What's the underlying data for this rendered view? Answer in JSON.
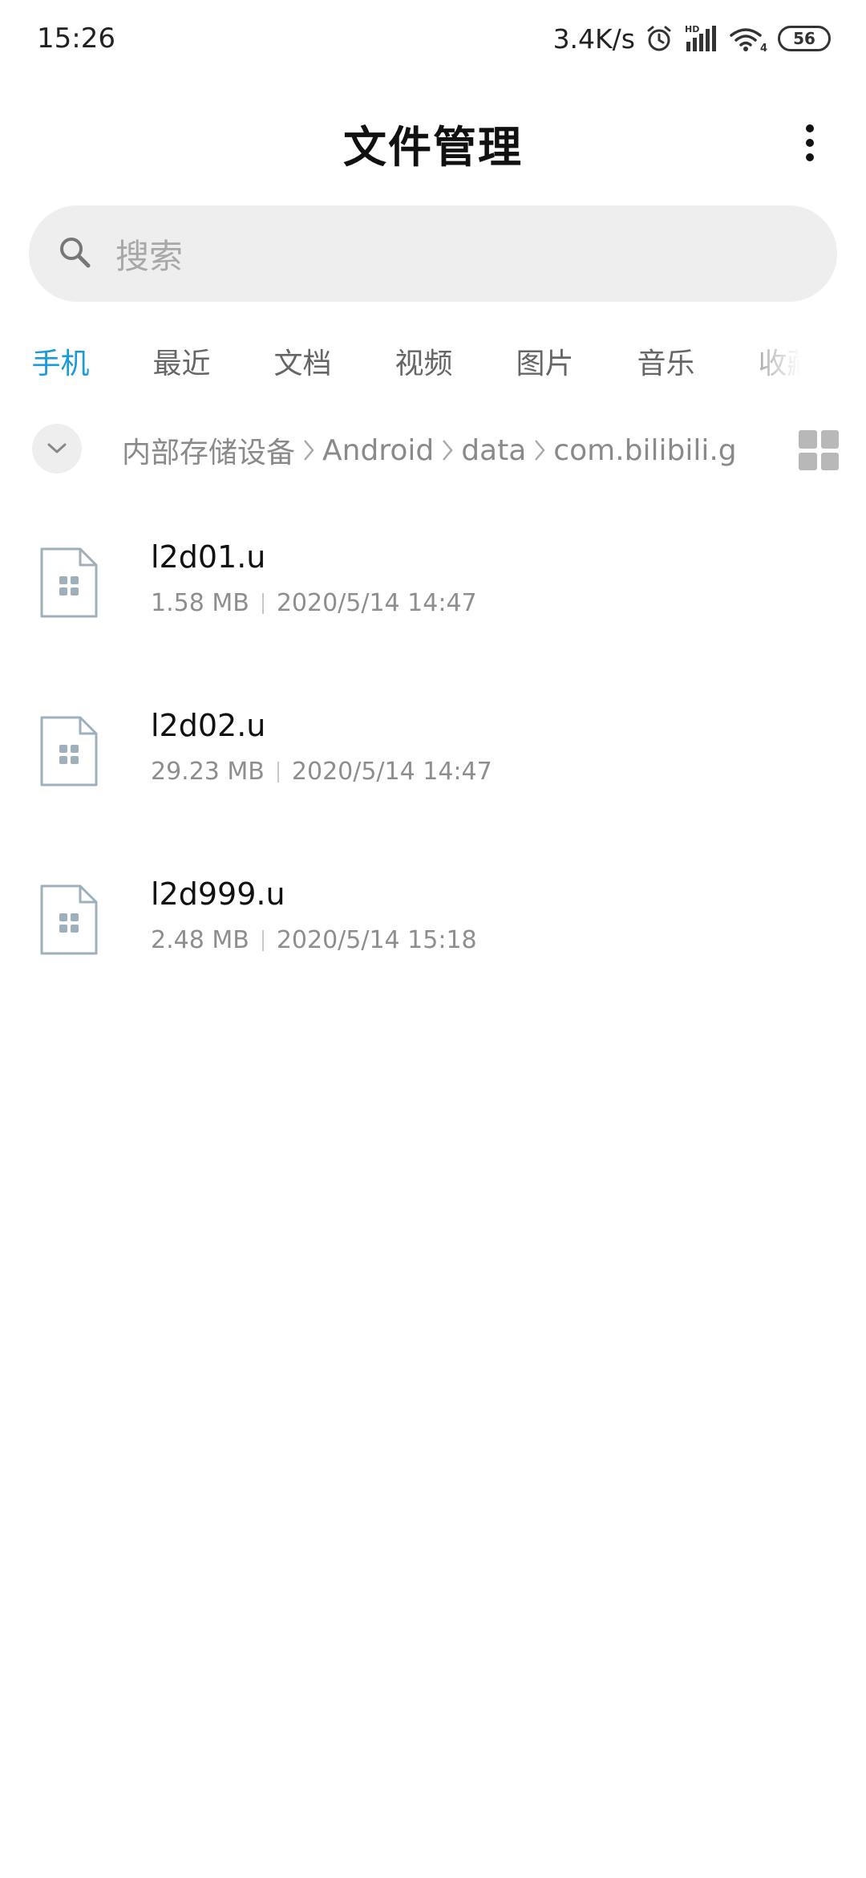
{
  "status_bar": {
    "time": "15:26",
    "network_speed": "3.4K/s",
    "hd_label": "HD",
    "wifi_label": "4",
    "battery": "56",
    "icons": [
      "alarm-icon",
      "signal-icon",
      "wifi-icon",
      "battery-icon"
    ]
  },
  "header": {
    "title": "文件管理"
  },
  "search": {
    "placeholder": "搜索"
  },
  "tabs": [
    {
      "label": "手机",
      "active": true
    },
    {
      "label": "最近",
      "active": false
    },
    {
      "label": "文档",
      "active": false
    },
    {
      "label": "视频",
      "active": false
    },
    {
      "label": "图片",
      "active": false
    },
    {
      "label": "音乐",
      "active": false
    },
    {
      "label": "收藏",
      "active": false
    }
  ],
  "breadcrumb": {
    "items": [
      "内部存储设备",
      "Android",
      "data",
      "com.bilibili.g"
    ]
  },
  "files": [
    {
      "name": "l2d01.u",
      "size": "1.58 MB",
      "modified": "2020/5/14 14:47"
    },
    {
      "name": "l2d02.u",
      "size": "29.23 MB",
      "modified": "2020/5/14 14:47"
    },
    {
      "name": "l2d999.u",
      "size": "2.48 MB",
      "modified": "2020/5/14 15:18"
    }
  ],
  "colors": {
    "accent": "#1a9ad8",
    "search_bg": "#eeeeee",
    "secondary_text": "#8e8e8e"
  }
}
